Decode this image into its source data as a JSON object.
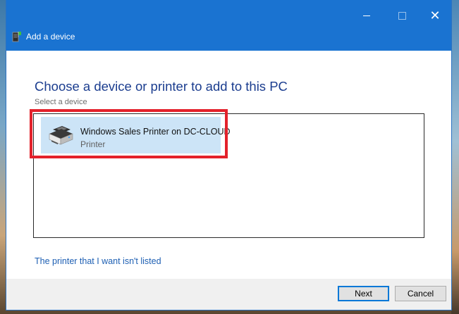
{
  "window": {
    "title": "Add a device",
    "controls": {
      "minimize": "minimize",
      "maximize": "maximize",
      "close": "✕"
    }
  },
  "main": {
    "heading": "Choose a device or printer to add to this PC",
    "subheading": "Select a device",
    "devices": [
      {
        "name": "Windows Sales Printer on DC-CLOUD",
        "type": "Printer",
        "icon": "printer-icon",
        "selected": true
      }
    ],
    "not_listed_link": "The printer that I want isn't listed"
  },
  "footer": {
    "next_label": "Next",
    "cancel_label": "Cancel"
  },
  "colors": {
    "titlebar": "#1a73d1",
    "heading": "#1b3d8f",
    "selection": "#cce4f7",
    "highlight": "#e3212b",
    "link": "#1d5fb3"
  }
}
